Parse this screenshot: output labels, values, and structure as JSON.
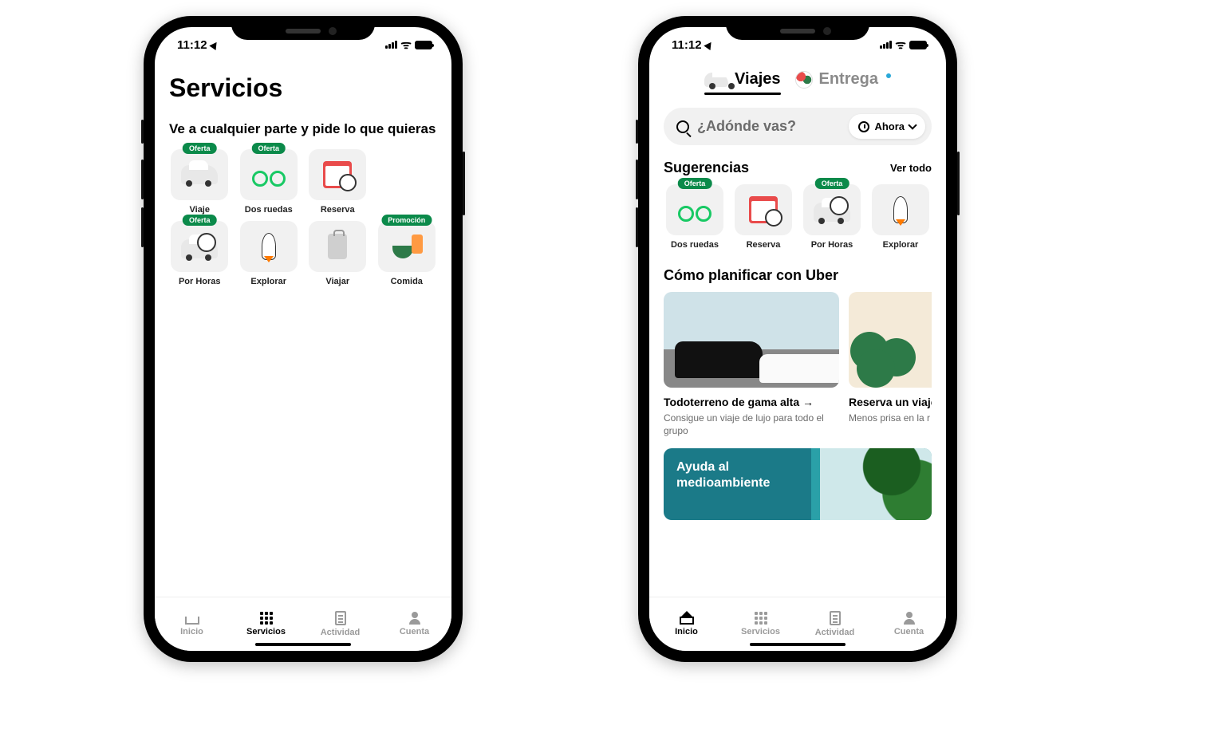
{
  "status": {
    "time": "11:12"
  },
  "phone1": {
    "title": "Servicios",
    "subtitle": "Ve a cualquier parte y pide lo que quieras",
    "tiles": [
      {
        "label": "Viaje",
        "badge": "Oferta"
      },
      {
        "label": "Dos ruedas",
        "badge": "Oferta"
      },
      {
        "label": "Reserva",
        "badge": ""
      },
      {
        "label": "Por Horas",
        "badge": "Oferta"
      },
      {
        "label": "Explorar",
        "badge": ""
      },
      {
        "label": "Viajar",
        "badge": ""
      },
      {
        "label": "Comida",
        "badge": "Promoción"
      }
    ],
    "nav": {
      "home": "Inicio",
      "services": "Servicios",
      "activity": "Actividad",
      "account": "Cuenta"
    }
  },
  "phone2": {
    "tabs": {
      "rides": "Viajes",
      "delivery": "Entrega"
    },
    "search": {
      "placeholder": "¿Adónde vas?",
      "now": "Ahora"
    },
    "suggestions": {
      "title": "Sugerencias",
      "see_all": "Ver todo",
      "tiles": [
        {
          "label": "Dos ruedas",
          "badge": "Oferta"
        },
        {
          "label": "Reserva",
          "badge": ""
        },
        {
          "label": "Por Horas",
          "badge": "Oferta"
        },
        {
          "label": "Explorar",
          "badge": ""
        }
      ]
    },
    "plan": {
      "title": "Cómo planificar con Uber",
      "cards": [
        {
          "heading": "Todoterreno de gama alta →",
          "sub": "Consigue un viaje de lujo para todo el grupo"
        },
        {
          "heading": "Reserva un viaje",
          "sub": "Menos prisa en la r"
        }
      ]
    },
    "env": {
      "line1": "Ayuda al",
      "line2": "medioambiente"
    },
    "nav": {
      "home": "Inicio",
      "services": "Servicios",
      "activity": "Actividad",
      "account": "Cuenta"
    }
  }
}
